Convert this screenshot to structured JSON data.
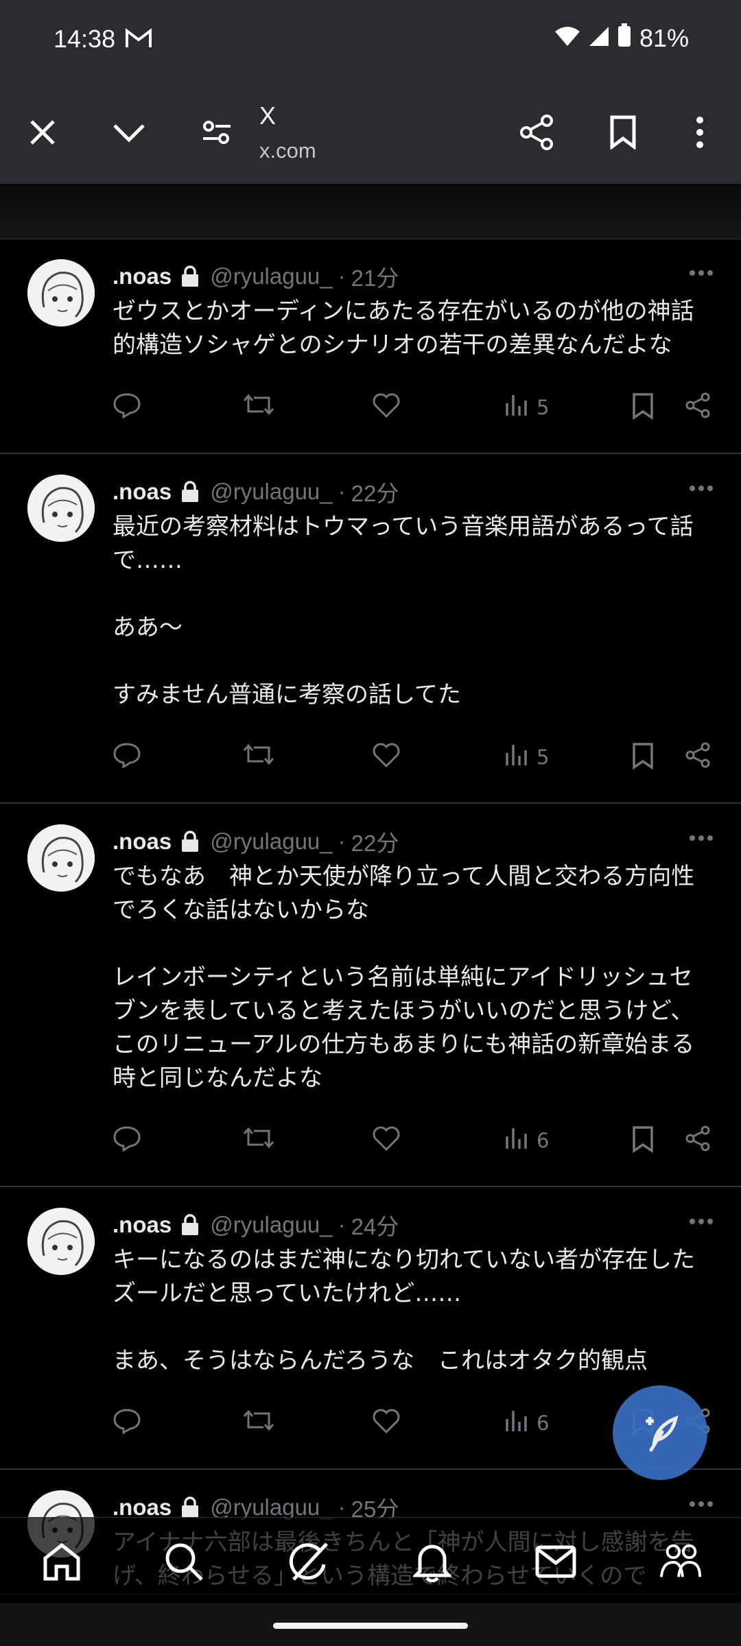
{
  "status": {
    "time": "14:38",
    "battery": "81%"
  },
  "browser": {
    "title": "X",
    "url": "x.com"
  },
  "posts": [
    {
      "name": ".noas",
      "handle": "@ryulaguu_",
      "time": "21分",
      "text": "ゼウスとかオーディンにあたる存在がいるのが他の神話的構造ソシャゲとのシナリオの若干の差異なんだよな",
      "views": "5"
    },
    {
      "name": ".noas",
      "handle": "@ryulaguu_",
      "time": "22分",
      "text": "最近の考察材料はトウマっていう音楽用語があるって話で……\n\nああ〜\n\nすみません普通に考察の話してた",
      "views": "5"
    },
    {
      "name": ".noas",
      "handle": "@ryulaguu_",
      "time": "22分",
      "text": "でもなあ　神とか天使が降り立って人間と交わる方向性でろくな話はないからな\n\nレインボーシティという名前は単純にアイドリッシュセブンを表していると考えたほうがいいのだと思うけど、このリニューアルの仕方もあまりにも神話の新章始まる時と同じなんだよな",
      "views": "6"
    },
    {
      "name": ".noas",
      "handle": "@ryulaguu_",
      "time": "24分",
      "text": "キーになるのはまだ神になり切れていない者が存在したズールだと思っていたけれど……\n\nまあ、そうはならんだろうな　これはオタク的観点",
      "views": "6"
    },
    {
      "name": ".noas",
      "handle": "@ryulaguu_",
      "time": "25分",
      "text": "アイナナ六部は最後きちんと「神が人間に対し感謝を告げ、終わらせる」という構造で終わらせていくので",
      "views": ""
    }
  ],
  "icons": {
    "close": "close-icon",
    "collapse": "chevron-down-icon",
    "settings": "tune-icon",
    "share": "share-icon",
    "bookmark": "bookmark-icon",
    "menu": "more-vert-icon",
    "reply": "reply-icon",
    "repost": "repost-icon",
    "like": "heart-icon",
    "views": "views-icon",
    "compose": "compose-icon",
    "home": "home-icon",
    "search": "search-icon",
    "grok": "grok-icon",
    "notifications": "bell-icon",
    "messages": "mail-icon",
    "communities": "communities-icon"
  },
  "colors": {
    "background": "#000000",
    "chrome": "#2b2c30",
    "muted": "#71767b",
    "fab": "#3a6fc0"
  }
}
